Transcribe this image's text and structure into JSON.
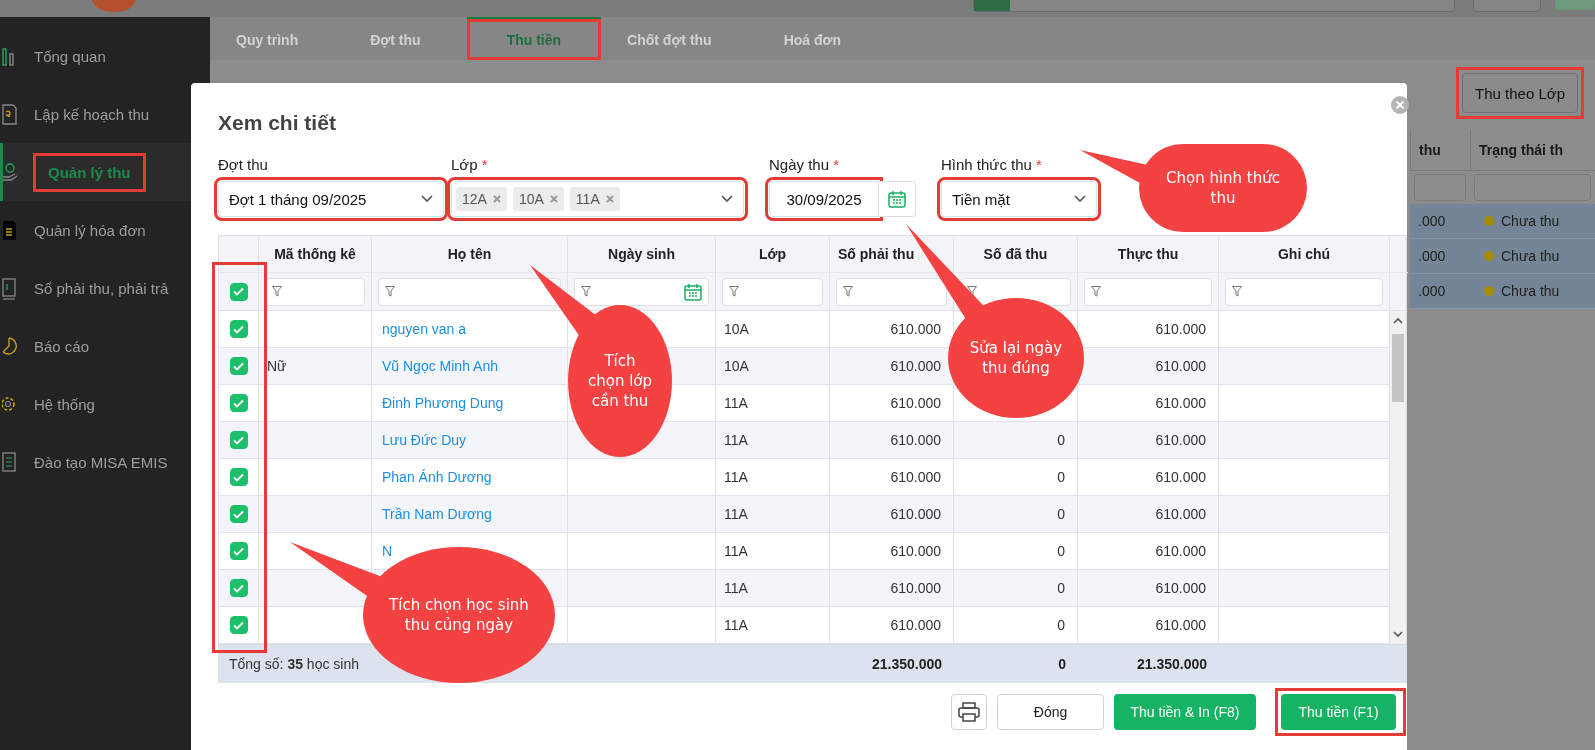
{
  "sidebar": {
    "items": [
      {
        "label": "Tổng quan",
        "selected": false,
        "highlighted": false
      },
      {
        "label": "Lập kế hoạch thu",
        "selected": false,
        "highlighted": false
      },
      {
        "label": "Quản lý thu",
        "selected": true,
        "highlighted": true
      },
      {
        "label": "Quản lý hóa đơn",
        "selected": false,
        "highlighted": false
      },
      {
        "label": "Sổ phải thu, phải trả",
        "selected": false,
        "highlighted": false
      },
      {
        "label": "Báo cáo",
        "selected": false,
        "highlighted": false
      },
      {
        "label": "Hệ thống",
        "selected": false,
        "highlighted": false
      },
      {
        "label": "Đào tạo MISA EMIS",
        "selected": false,
        "highlighted": false
      }
    ]
  },
  "tabs": [
    {
      "label": "Quy trình",
      "selected": false,
      "highlighted": false
    },
    {
      "label": "Đợt thu",
      "selected": false,
      "highlighted": false
    },
    {
      "label": "Thu tiền",
      "selected": true,
      "highlighted": true
    },
    {
      "label": "Chốt đợt thu",
      "selected": false,
      "highlighted": false
    },
    {
      "label": "Hoá đơn",
      "selected": false,
      "highlighted": false
    }
  ],
  "toolbar": {
    "button": {
      "label": "Thu theo Lớp",
      "highlighted": true
    }
  },
  "background_table": {
    "columns": [
      "thu",
      "Trạng thái th"
    ],
    "rows": [
      {
        "amount": ".000",
        "status": "Chưa thu",
        "color": "#a88c00"
      },
      {
        "amount": ".000",
        "status": "Chưa thu",
        "color": "#a88c00"
      },
      {
        "amount": ".000",
        "status": "Chưa thu",
        "color": "#a88c00"
      }
    ]
  },
  "modal": {
    "title": "Xem chi tiết",
    "fields": [
      {
        "kind": "select",
        "label": "Đợt thu",
        "value": "Đợt 1 tháng 09/2025",
        "highlighted": true
      },
      {
        "kind": "tags",
        "label": "Lớp",
        "required_mark": "*",
        "tags": [
          "12A",
          "10A",
          "11A"
        ],
        "highlighted": true
      },
      {
        "kind": "date",
        "label": "Ngày thu",
        "required_mark": "*",
        "value": "30/09/2025",
        "highlighted": true
      },
      {
        "kind": "select",
        "label": "Hình thức thu",
        "required_mark": "*",
        "value": "Tiền mặt",
        "highlighted": true
      }
    ],
    "table": {
      "all_checked": true,
      "checkbox_column_highlighted": true,
      "columns": [
        "Mã thống kê",
        "Họ tên",
        "Ngày sinh",
        "Lớp",
        "Số phải thu",
        "Số đã thu",
        "Thực thu",
        "Ghi chú"
      ],
      "rows": [
        {
          "checked": true,
          "name": "nguyen van a",
          "class": "10A",
          "due": "610.000",
          "actual": "610.000"
        },
        {
          "checked": true,
          "code": "Nữ",
          "name": "Vũ Ngọc Minh Anh",
          "class": "10A",
          "due": "610.000",
          "actual": "610.000"
        },
        {
          "checked": true,
          "name": "Đinh Phương Dung",
          "class": "11A",
          "due": "610.000",
          "actual": "610.000"
        },
        {
          "checked": true,
          "name": "Lưu Đức Duy",
          "class": "11A",
          "due": "610.000",
          "paid": "0",
          "actual": "610.000"
        },
        {
          "checked": true,
          "name": "Phan Ánh Dương",
          "class": "11A",
          "due": "610.000",
          "paid": "0",
          "actual": "610.000"
        },
        {
          "checked": true,
          "name": "Trần Nam Dương",
          "class": "11A",
          "due": "610.000",
          "paid": "0",
          "actual": "610.000"
        },
        {
          "checked": true,
          "name": "N",
          "class": "11A",
          "due": "610.000",
          "paid": "0",
          "actual": "610.000"
        },
        {
          "checked": true,
          "class": "11A",
          "due": "610.000",
          "paid": "0",
          "actual": "610.000"
        },
        {
          "checked": true,
          "class": "11A",
          "due": "610.000",
          "paid": "0",
          "actual": "610.000"
        }
      ],
      "footer": {
        "label": "Tổng số: **35** học sinh",
        "due": "21.350.000",
        "paid": "0",
        "actual": "21.350.000"
      }
    },
    "buttons": [
      {
        "kind": "print",
        "highlighted": false
      },
      {
        "kind": "secondary",
        "label": "Đóng",
        "highlighted": false
      },
      {
        "kind": "primary",
        "label": "Thu tiền & In (F8)",
        "highlighted": false
      },
      {
        "kind": "primary",
        "label": "Thu tiền (F1)",
        "highlighted": true
      }
    ]
  },
  "callouts": [
    {
      "text": "Tích chọn lớp cần thu"
    },
    {
      "text": "Sửa lại ngày thu đúng"
    },
    {
      "text": "Chọn hình thức thu"
    },
    {
      "text": "Tích chọn học sinh thu củng ngày"
    }
  ]
}
